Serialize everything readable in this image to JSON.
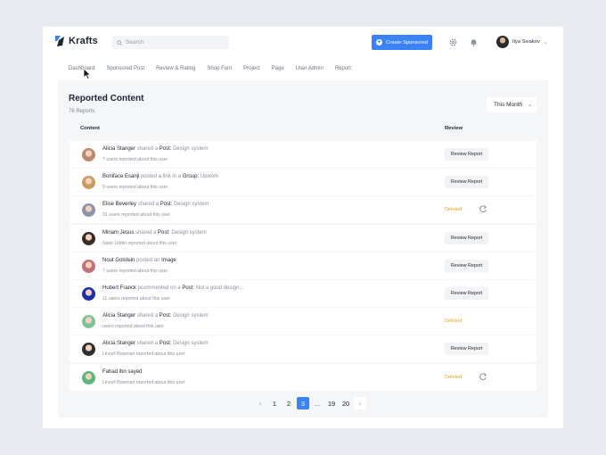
{
  "app": {
    "name": "Krafts"
  },
  "header": {
    "search_placeholder": "Search",
    "create_label": "Create Sponsored",
    "user_name": "Ilya Sivakov"
  },
  "nav": [
    "Dashboard",
    "Sponsored Post",
    "Review & Rating",
    "Shop Font",
    "Project",
    "Page",
    "User Admin",
    "Report"
  ],
  "page": {
    "title": "Reported Content",
    "count": "76 Reports",
    "filter": "This Month",
    "col_content": "Content",
    "col_review": "Review"
  },
  "rows": [
    {
      "name": "Alicia Stanger",
      "action": "shared a",
      "obj_label": "Post:",
      "obj": "Design system",
      "sub": "7 users reported about this user",
      "status": "button",
      "review_label": "Review Report",
      "avatar_color": "#b98a6e"
    },
    {
      "name": "Boniface Esanji",
      "action": "posted a link in a",
      "obj_label": "Group:",
      "obj": "Upwork",
      "sub": "9 users reported about this user",
      "status": "button",
      "review_label": "Review Report",
      "avatar_color": "#c99b5f"
    },
    {
      "name": "Elise Beverley",
      "action": "shared a",
      "obj_label": "Post:",
      "obj": "Design system",
      "sub": "31 users reported about this user",
      "status": "deleted",
      "deleted_label": "Deleted",
      "avatar_color": "#8c93ad"
    },
    {
      "name": "Miriam Jesus",
      "action": "shared a",
      "obj_label": "Post:",
      "obj": "Design system",
      "sub": "Nasir Uddin reported about this user",
      "status": "button",
      "review_label": "Review Report",
      "avatar_color": "#3a2a2a"
    },
    {
      "name": "Nout Golstein",
      "action": "posted an",
      "obj_label": "Image",
      "obj": "",
      "sub": "7 users reported about this user",
      "status": "button",
      "review_label": "Review Report",
      "avatar_color": "#c2707a"
    },
    {
      "name": "Hubert Franck",
      "action": "pcommented on a",
      "obj_label": "Post:",
      "obj": "Not a good design...",
      "sub": "11 users reported about this user",
      "status": "button",
      "review_label": "Review Report",
      "avatar_color": "#1b2fa8"
    },
    {
      "name": "Alicia Stanger",
      "action": "shared a",
      "obj_label": "Post:",
      "obj": "Design system",
      "sub": "users reported about this user",
      "status": "deleted",
      "deleted_label": "Deleted",
      "avatar_color": "#7fc29a"
    },
    {
      "name": "Alicia Stanger",
      "action": "shared a",
      "obj_label": "Post:",
      "obj": "Design system",
      "sub": "Linzell Bowman reported about this user",
      "status": "button",
      "review_label": "Review Report",
      "avatar_color": "#2f2f2f"
    },
    {
      "name": "Fahad ibn sayed",
      "action": "",
      "obj_label": "",
      "obj": "",
      "sub": "Linzell Bowman reported about this user",
      "status": "deleted",
      "deleted_label": "Deleted",
      "avatar_color": "#57b87a"
    }
  ],
  "pagination": {
    "pages": [
      "1",
      "2",
      "3",
      "...",
      "19",
      "20"
    ],
    "active": "3"
  },
  "colors": {
    "accent": "#3b82f6",
    "deleted": "#e2a320"
  }
}
